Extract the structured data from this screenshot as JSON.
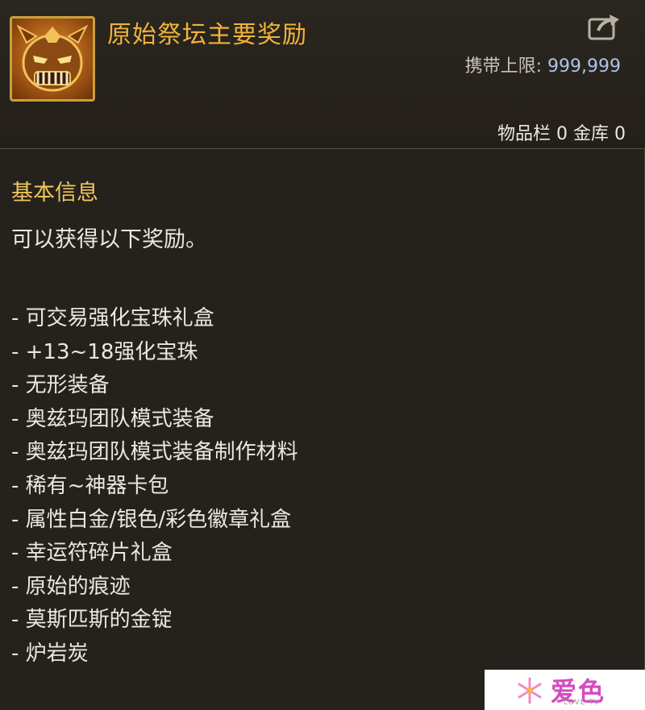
{
  "item": {
    "title": "原始祭坛主要奖励",
    "icon": "demon-mask-icon",
    "carry_limit_label": "携带上限:",
    "carry_limit_value": "999,999",
    "storage_text": "物品栏 0 金库 0"
  },
  "colors": {
    "title": "#f0b23a",
    "section_title": "#f1c75a",
    "limit_value": "#aec3e6",
    "text": "#ece8e0",
    "background": "#25211c"
  },
  "info": {
    "section_title": "基本信息",
    "description": "可以获得以下奖励。",
    "rewards": [
      "- 可交易强化宝珠礼盒",
      "- +13~18强化宝珠",
      "- 无形装备",
      "- 奥兹玛团队模式装备",
      "- 奥兹玛团队模式装备制作材料",
      "- 稀有~神器卡包",
      "- 属性白金/银色/彩色徽章礼盒",
      "- 幸运符碎片礼盒",
      "- 原始的痕迹",
      "- 莫斯匹斯的金锭",
      "- 炉岩炭"
    ]
  },
  "watermark": {
    "text": "爱色",
    "sub": "LOVE TV",
    "icon": "snowflake-icon"
  }
}
